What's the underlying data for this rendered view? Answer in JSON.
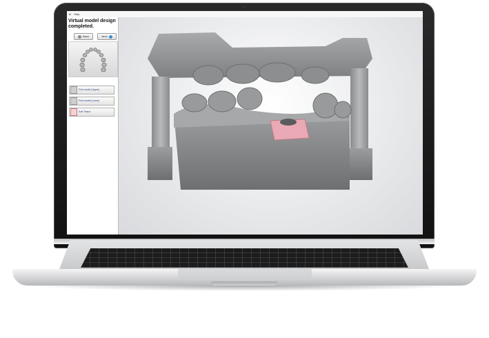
{
  "menubar": {
    "items": [
      "le",
      "Help"
    ]
  },
  "sidebar": {
    "header": "Virtual model design completed.",
    "nav": {
      "back_label": "Back",
      "next_label": "Next"
    },
    "steps": [
      {
        "label": "Find model (Upper)",
        "icon": "model-icon"
      },
      {
        "label": "Find model (Lower)",
        "icon": "model-icon"
      },
      {
        "label": "Soft Tissue",
        "icon": "soft-tissue-icon"
      }
    ]
  },
  "viewport": {
    "content": "3d-dental-model-icon"
  },
  "colors": {
    "accent": "#3b8ed8",
    "soft_tissue": "#e9aab5",
    "model_gray": "#8f9092"
  }
}
